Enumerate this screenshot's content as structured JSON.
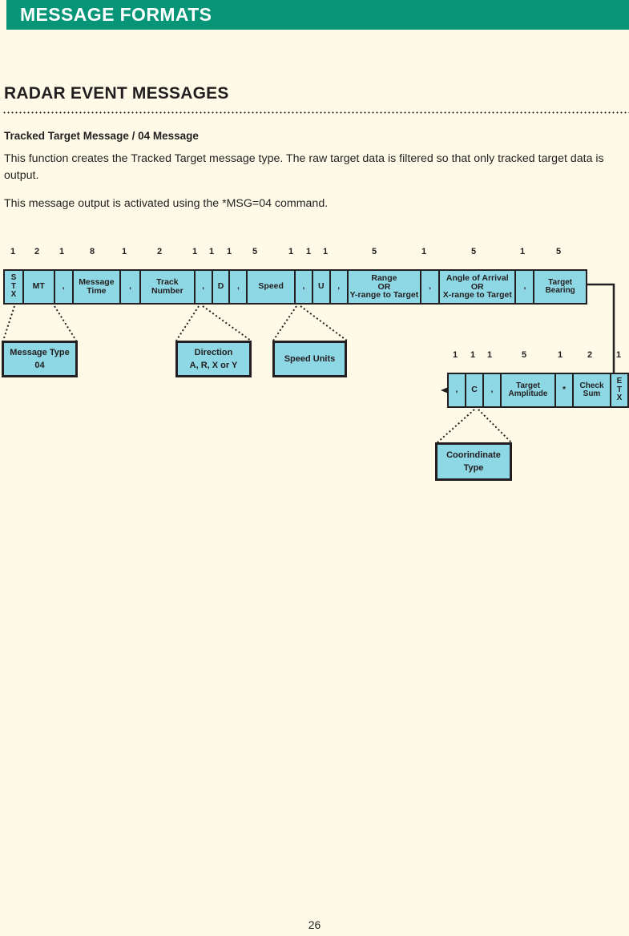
{
  "header": {
    "title": "MESSAGE FORMATS",
    "bar_color": "#079577"
  },
  "section": {
    "heading": "RADAR EVENT MESSAGES"
  },
  "body": {
    "subheading": "Tracked Target Message / 04 Message",
    "paragraph_1": "This function creates the Tracked Target message type.  The raw target data is filtered so that only tracked target data is output.",
    "paragraph_2": "This message output is activated using the *MSG=04 command."
  },
  "diagram": {
    "field_fill_color": "#8ed7e4",
    "row1": {
      "sizes": [
        "1",
        "2",
        "1",
        "8",
        "1",
        "2",
        "1",
        "1",
        "1",
        "5",
        "1",
        "1",
        "1",
        "5",
        "1",
        "5",
        "1",
        "5"
      ],
      "cells": [
        {
          "label": "STX",
          "stacked": true,
          "size": "1"
        },
        {
          "label": "MT",
          "size": "2"
        },
        {
          "label": ",",
          "size": "1"
        },
        {
          "label": "Message Time",
          "size": "8"
        },
        {
          "label": ",",
          "size": "1"
        },
        {
          "label": "Track Number",
          "size": "2"
        },
        {
          "label": ",",
          "size": "1"
        },
        {
          "label": "D",
          "size": "1"
        },
        {
          "label": ",",
          "size": "1"
        },
        {
          "label": "Speed",
          "size": "5"
        },
        {
          "label": ",",
          "size": "1"
        },
        {
          "label": "U",
          "size": "1"
        },
        {
          "label": ",",
          "size": "1"
        },
        {
          "label": "Range OR Y-range to Target",
          "size": "5"
        },
        {
          "label": ",",
          "size": "1"
        },
        {
          "label": "Angle of Arrival OR X-range to Target",
          "size": "5"
        },
        {
          "label": ",",
          "size": "1"
        },
        {
          "label": "Target Bearing",
          "size": "5"
        }
      ]
    },
    "row2": {
      "sizes": [
        "1",
        "1",
        "1",
        "5",
        "1",
        "2",
        "1"
      ],
      "cells": [
        {
          "label": ",",
          "size": "1"
        },
        {
          "label": "C",
          "size": "1"
        },
        {
          "label": ",",
          "size": "1"
        },
        {
          "label": "Target Amplitude",
          "size": "5"
        },
        {
          "label": "*",
          "size": "1"
        },
        {
          "label": "Check Sum",
          "size": "2"
        },
        {
          "label": "ETX",
          "stacked": true,
          "size": "1"
        }
      ]
    },
    "callouts": [
      {
        "name": "message-type",
        "line1": "Message Type",
        "line2": "04"
      },
      {
        "name": "direction",
        "line1": "Direction",
        "line2": "A, R, X or Y"
      },
      {
        "name": "speed-units",
        "line1": "Speed Units",
        "line2": ""
      },
      {
        "name": "coordinate-type",
        "line1": "Coorindinate",
        "line2": "Type"
      }
    ]
  },
  "footer": {
    "page_number": "26"
  }
}
